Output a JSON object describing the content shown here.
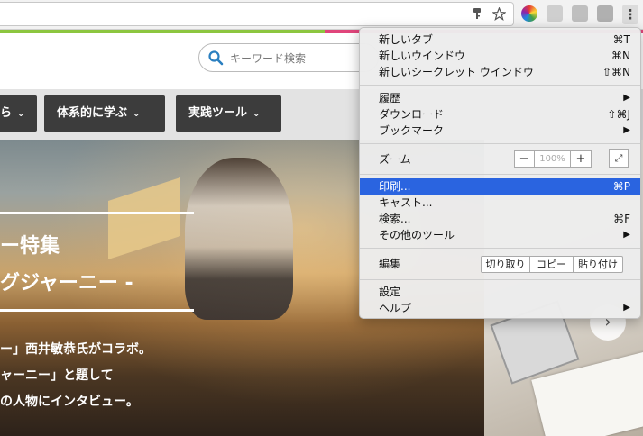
{
  "browser": {
    "colors": {
      "accent_green": "#8cc63f",
      "accent_pink": "#e0457b",
      "menu_highlight": "#2a64e0"
    },
    "toolbar_icons": [
      "key-icon",
      "bookmark-star-icon",
      "color-extension-icon",
      "chat-extension-icon",
      "evernote-extension-icon",
      "tabs-extension-icon",
      "menu-dots-icon"
    ],
    "menu": {
      "new_tab": {
        "label": "新しいタブ",
        "shortcut": "⌘T"
      },
      "new_window": {
        "label": "新しいウインドウ",
        "shortcut": "⌘N"
      },
      "new_incognito": {
        "label": "新しいシークレット ウインドウ",
        "shortcut": "⇧⌘N"
      },
      "history": {
        "label": "履歴",
        "arrow": "▶"
      },
      "downloads": {
        "label": "ダウンロード",
        "shortcut": "⇧⌘J"
      },
      "bookmarks": {
        "label": "ブックマーク",
        "arrow": "▶"
      },
      "zoom": {
        "label": "ズーム",
        "minus": "−",
        "value": "100%",
        "plus": "+"
      },
      "print": {
        "label": "印刷...",
        "shortcut": "⌘P"
      },
      "cast": {
        "label": "キャスト..."
      },
      "find": {
        "label": "検索...",
        "shortcut": "⌘F"
      },
      "more_tools": {
        "label": "その他のツール",
        "arrow": "▶"
      },
      "edit": {
        "label": "編集",
        "cut": "切り取り",
        "copy": "コピー",
        "paste": "貼り付け"
      },
      "settings": {
        "label": "設定"
      },
      "help": {
        "label": "ヘルプ",
        "arrow": "▶"
      }
    }
  },
  "site": {
    "search": {
      "placeholder": "キーワード検索"
    },
    "nav": [
      {
        "label": "ら",
        "chevron": "⌄"
      },
      {
        "label": "体系的に学ぶ",
        "chevron": "⌄"
      },
      {
        "label": "実践ツール",
        "chevron": "⌄"
      }
    ],
    "hero": {
      "title_line1": "ー特集",
      "title_line2": "グジャーニー -",
      "text_line1": "ー」西井敏恭氏がコラボ。",
      "text_line2": "ャーニー」と題して",
      "text_line3": "の人物にインタビュー。"
    },
    "next_arrow": "›"
  }
}
